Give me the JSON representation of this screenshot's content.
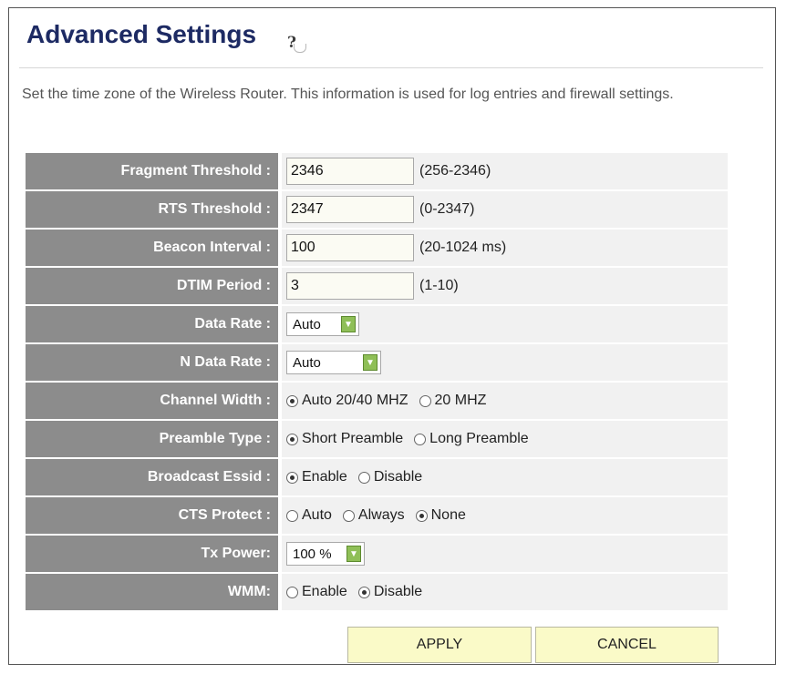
{
  "header": {
    "title": "Advanced Settings",
    "help_icon": "help-question-icon"
  },
  "description": "Set the time zone of the Wireless Router. This information is used for log entries and firewall settings.",
  "fields": {
    "fragment_threshold": {
      "label": "Fragment Threshold :",
      "value": "2346",
      "range": "(256-2346)"
    },
    "rts_threshold": {
      "label": "RTS Threshold :",
      "value": "2347",
      "range": "(0-2347)"
    },
    "beacon_interval": {
      "label": "Beacon Interval :",
      "value": "100",
      "range": "(20-1024 ms)"
    },
    "dtim_period": {
      "label": "DTIM Period :",
      "value": "3",
      "range": "(1-10)"
    },
    "data_rate": {
      "label": "Data Rate :",
      "selected": "Auto"
    },
    "n_data_rate": {
      "label": "N Data Rate :",
      "selected": "Auto"
    },
    "channel_width": {
      "label": "Channel Width :",
      "options": [
        "Auto 20/40 MHZ",
        "20 MHZ"
      ],
      "selected": "Auto 20/40 MHZ"
    },
    "preamble_type": {
      "label": "Preamble Type :",
      "options": [
        "Short Preamble",
        "Long Preamble"
      ],
      "selected": "Short Preamble"
    },
    "broadcast_essid": {
      "label": "Broadcast Essid :",
      "options": [
        "Enable",
        "Disable"
      ],
      "selected": "Enable"
    },
    "cts_protect": {
      "label": "CTS Protect :",
      "options": [
        "Auto",
        "Always",
        "None"
      ],
      "selected": "None"
    },
    "tx_power": {
      "label": "Tx Power:",
      "selected": "100 %"
    },
    "wmm": {
      "label": "WMM:",
      "options": [
        "Enable",
        "Disable"
      ],
      "selected": "Disable"
    }
  },
  "buttons": {
    "apply": "APPLY",
    "cancel": "CANCEL"
  },
  "colors": {
    "title": "#1d2a63",
    "label_bg": "#8c8c8c",
    "value_bg": "#f1f1f1",
    "input_bg": "#fbfbf3",
    "button_bg": "#fafac8",
    "select_arrow": "#8fbf57"
  }
}
